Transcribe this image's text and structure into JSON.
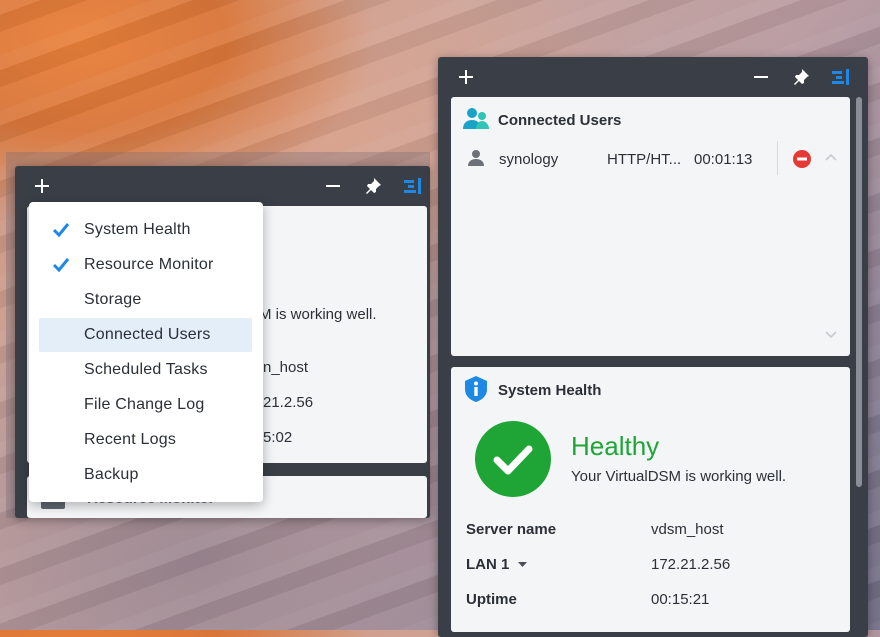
{
  "colors": {
    "accent_blue": "#1e88e5",
    "healthy_green": "#1ea536",
    "danger_red": "#e53935",
    "panel_dark": "#3a3f47"
  },
  "left_panel": {
    "toolbar": {
      "add_icon": "plus-icon",
      "minimize_icon": "minus-icon",
      "pin_icon": "pin-icon",
      "layout_icon": "layout-icon"
    },
    "behind_text": {
      "working": "M is working well.",
      "server": "n_host",
      "lan": "21.2.56",
      "uptime": "5:02",
      "next_widget": "Resource Monitor"
    },
    "menu": {
      "items": [
        {
          "label": "System Health",
          "checked": true
        },
        {
          "label": "Resource Monitor",
          "checked": true
        },
        {
          "label": "Storage",
          "checked": false
        },
        {
          "label": "Connected Users",
          "checked": false
        },
        {
          "label": "Scheduled Tasks",
          "checked": false
        },
        {
          "label": "File Change Log",
          "checked": false
        },
        {
          "label": "Recent Logs",
          "checked": false
        },
        {
          "label": "Backup",
          "checked": false
        }
      ]
    }
  },
  "right_panel": {
    "connected_users": {
      "title": "Connected Users",
      "user": "synology",
      "protocol": "HTTP/HT...",
      "duration": "00:01:13"
    },
    "system_health": {
      "title": "System Health",
      "status": "Healthy",
      "message": "Your VirtualDSM is working well.",
      "server_name_label": "Server name",
      "server_name": "vdsm_host",
      "lan_label": "LAN 1",
      "lan_value": "172.21.2.56",
      "uptime_label": "Uptime",
      "uptime_value": "00:15:21"
    }
  }
}
